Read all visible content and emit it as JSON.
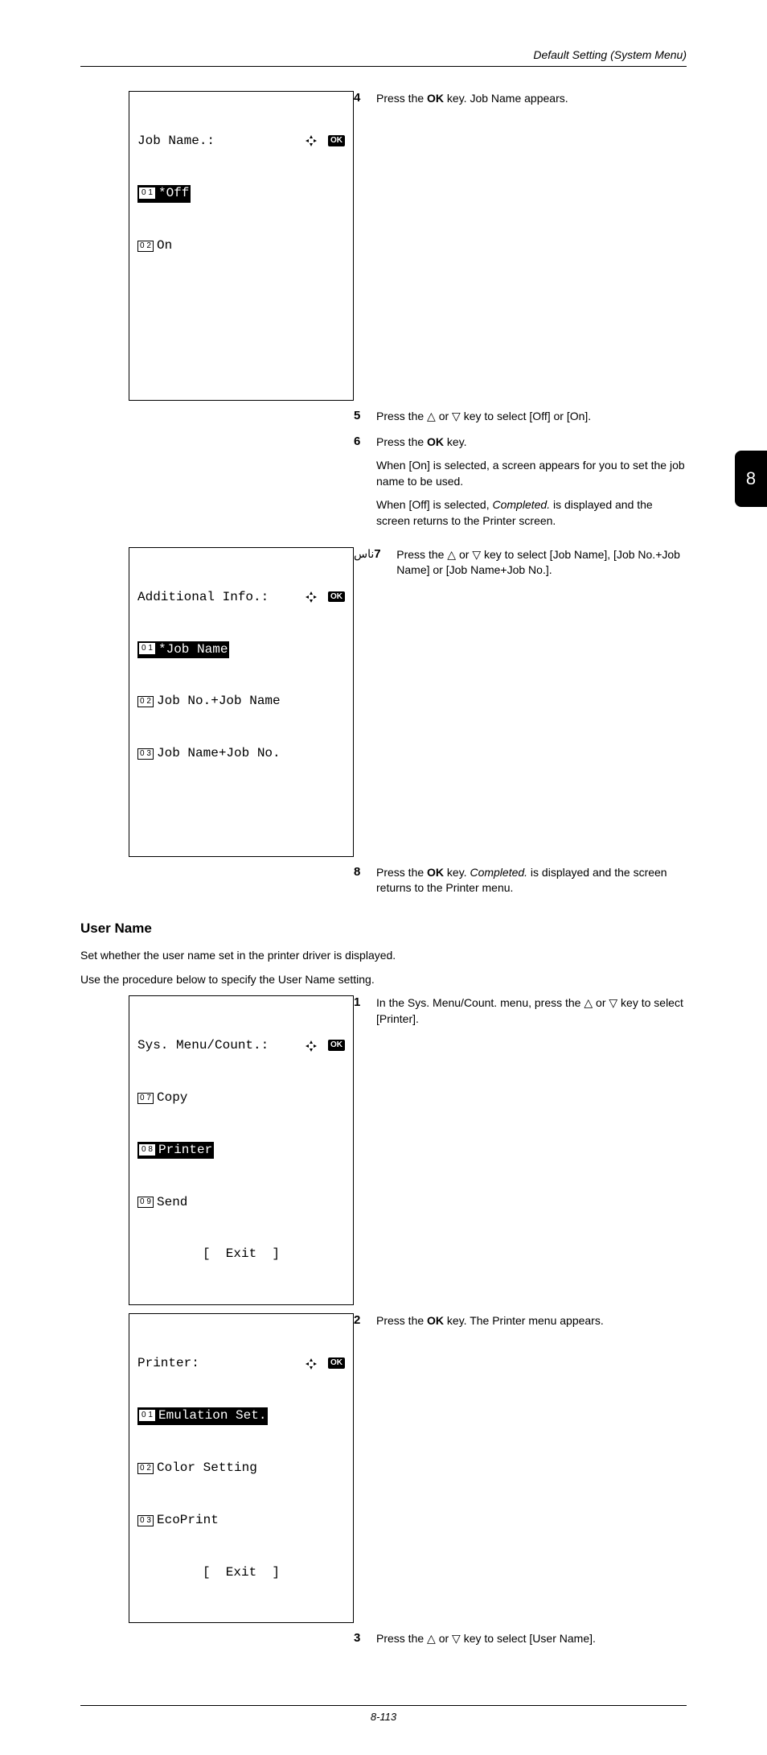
{
  "header": {
    "section": "Default Setting (System Menu)"
  },
  "footer": {
    "page_number": "8-113"
  },
  "side_tab": {
    "number": "8"
  },
  "lcd_job_name": {
    "title": "Job Name.:",
    "line1_num": "0 1",
    "line1_text": "*Off",
    "line2_num": "0 2",
    "line2_text": "On"
  },
  "lcd_additional": {
    "title": "Additional Info.:",
    "line1_num": "0 1",
    "line1_text": "*Job Name",
    "line2_num": "0 2",
    "line2_text": "Job No.+Job Name",
    "line3_num": "0 3",
    "line3_text": "Job Name+Job No."
  },
  "lcd_sys": {
    "title": "Sys. Menu/Count.:",
    "line1_num": "0 7",
    "line1_text": "Copy",
    "line2_num": "0 8",
    "line2_text": "Printer",
    "line3_num": "0 9",
    "line3_text": "Send",
    "exit": "[  Exit  ]"
  },
  "lcd_printer": {
    "title": "Printer:",
    "line1_num": "0 1",
    "line1_text": "Emulation Set.",
    "line2_num": "0 2",
    "line2_text": "Color Setting",
    "line3_num": "0 3",
    "line3_text": "EcoPrint",
    "exit": "[  Exit  ]"
  },
  "steps": {
    "s4": {
      "num": "4",
      "pre": "Press the ",
      "bold": "OK",
      "post": " key. Job Name appears."
    },
    "s5": {
      "num": "5",
      "pre": "Press the ",
      "mid": " or ",
      "post": " key to select [Off] or [On]."
    },
    "s6": {
      "num": "6",
      "pre": "Press the ",
      "bold": "OK",
      "post": " key.",
      "sub1": "When [On] is selected, a screen appears for you to set the job name to be used.",
      "sub2a": "When [Off] is selected, ",
      "sub2italic": "Completed.",
      "sub2b": " is displayed and the screen returns to the Printer screen."
    },
    "s7": {
      "num": "7",
      "pre": "Press the ",
      "mid": " or ",
      "post": " key to select [Job Name], [Job No.+Job Name] or [Job Name+Job No.]."
    },
    "s8": {
      "num": "8",
      "pre": "Press the ",
      "bold": "OK",
      "mid": " key. ",
      "italic": "Completed.",
      "post": " is displayed and the screen returns to the Printer menu."
    },
    "s1": {
      "num": "1",
      "pre": "In the Sys. Menu/Count. menu, press the ",
      "mid": " or ",
      "post": " key to select [Printer]."
    },
    "s2": {
      "num": "2",
      "pre": "Press the ",
      "bold": "OK",
      "post": " key. The Printer menu appears."
    },
    "s3": {
      "num": "3",
      "pre": "Press the ",
      "mid": " or ",
      "post": " key to select [User Name]."
    }
  },
  "section": {
    "title": "User Name",
    "para1": "Set whether the user name set in the printer driver is displayed.",
    "para2": "Use the procedure below to specify the User Name setting."
  },
  "icons": {
    "ok": "OK",
    "nav": "a"
  }
}
